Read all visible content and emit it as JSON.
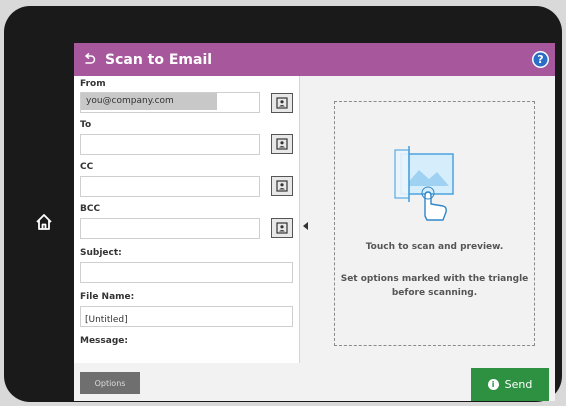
{
  "header": {
    "title": "Scan to Email",
    "help_glyph": "?"
  },
  "form": {
    "from_label": "From",
    "from_value": "you@company.com",
    "to_label": "To",
    "cc_label": "CC",
    "bcc_label": "BCC",
    "subject_label": "Subject:",
    "subject_value": "",
    "filename_label": "File Name:",
    "filename_value": "[Untitled]",
    "message_label": "Message:"
  },
  "preview": {
    "line1": "Touch to scan and preview.",
    "line2": "Set options marked with the triangle before scanning."
  },
  "footer": {
    "options_label": "Options",
    "send_label": "Send",
    "info_glyph": "i"
  },
  "icons": {
    "home": "home-icon",
    "back": "back-arrow-icon",
    "help": "help-icon",
    "contact": "address-book-icon",
    "collapse": "collapse-arrow-icon",
    "preview": "touch-preview-icon",
    "info": "info-icon"
  },
  "colors": {
    "header_bg": "#a7579b",
    "help_bg": "#2a6ec7",
    "send_bg": "#2e9142",
    "options_bg": "#6f6f6f"
  }
}
